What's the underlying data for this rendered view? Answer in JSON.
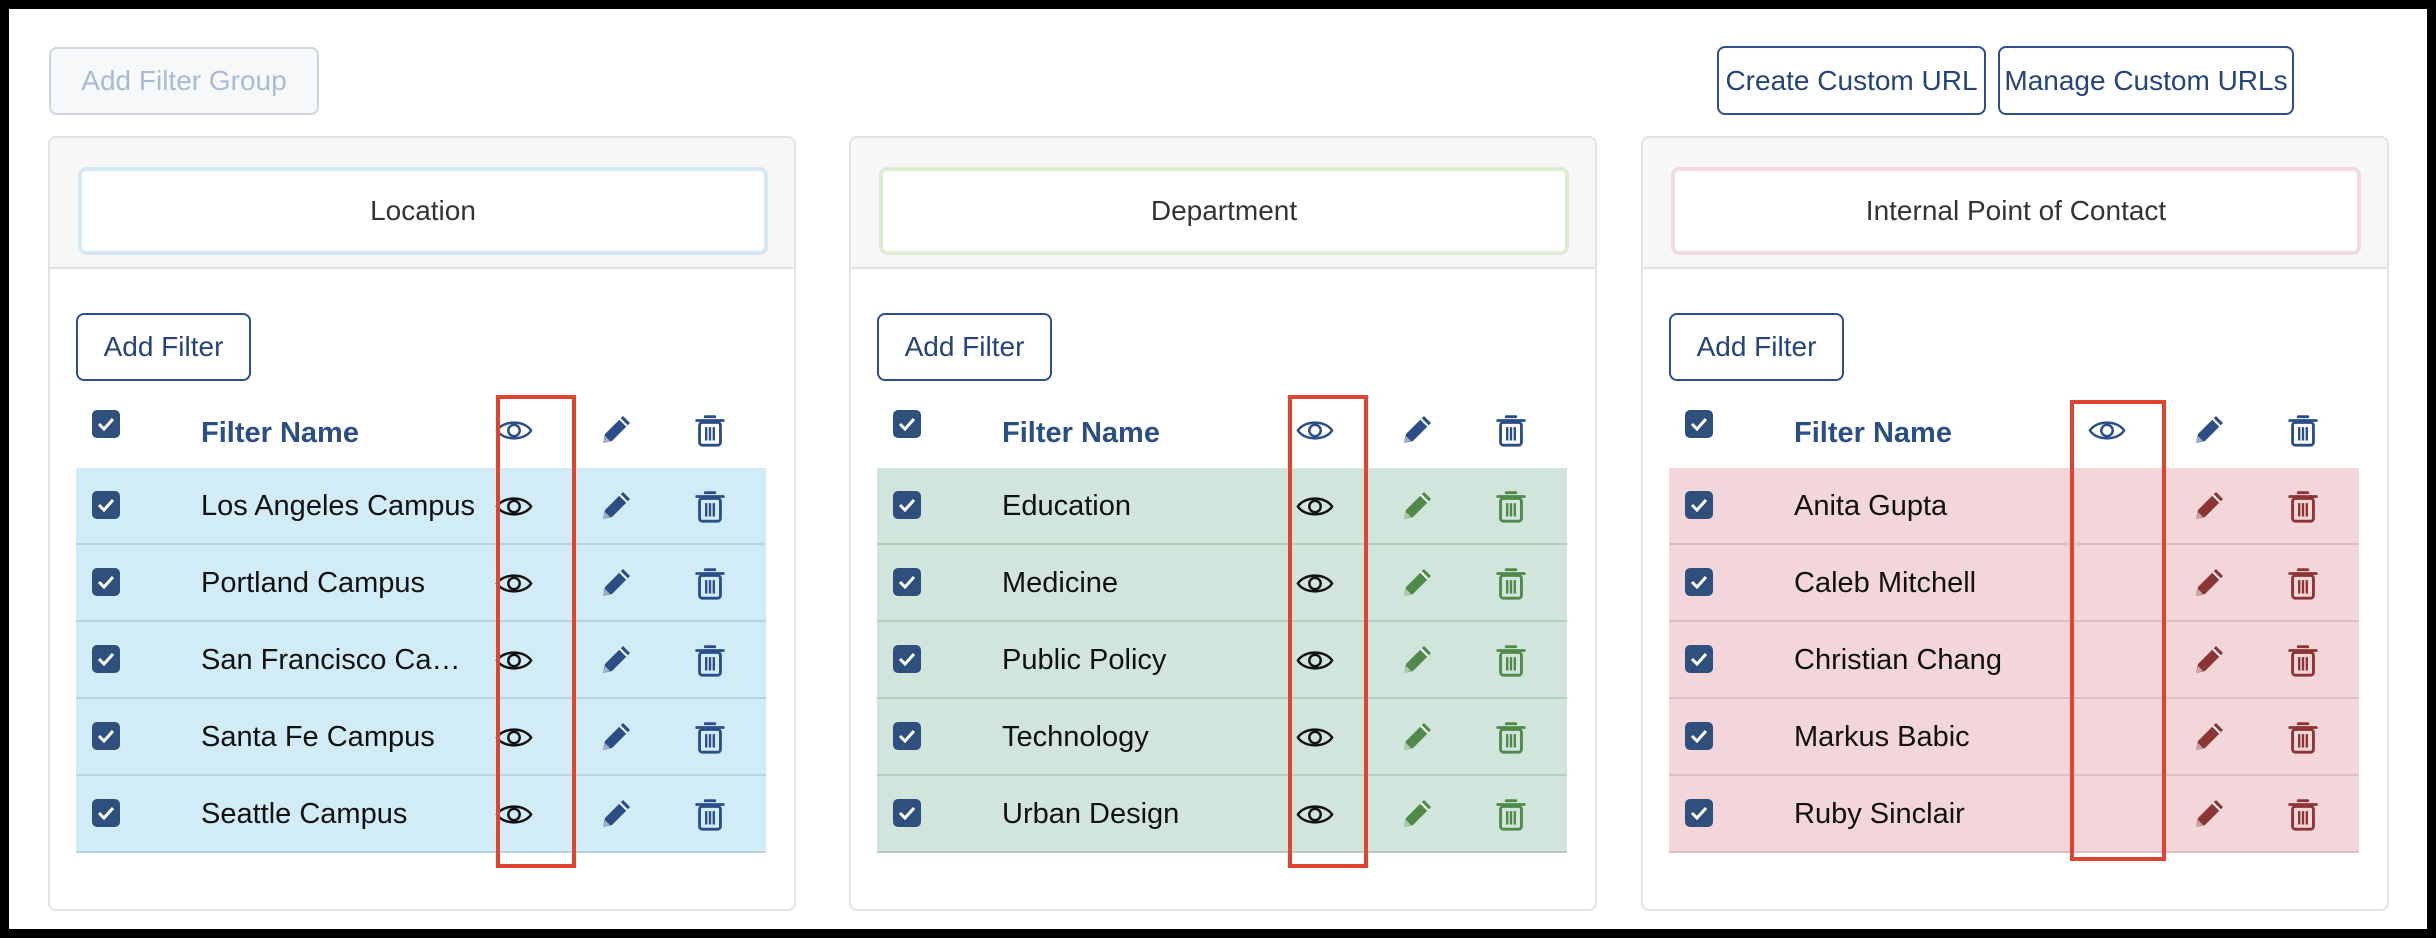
{
  "toolbar": {
    "add_filter_group_label": "Add Filter Group",
    "create_custom_url_label": "Create Custom URL",
    "manage_custom_urls_label": "Manage Custom URLs"
  },
  "colors": {
    "primary": "#2f4f7d",
    "highlight": "#e0442e",
    "location_row": "#d1ecf6",
    "department_row": "#d1e5dc",
    "contact_row": "#f2d6da"
  },
  "groups": [
    {
      "title": "Location",
      "add_filter_label": "Add Filter",
      "column_header": "Filter Name",
      "rows": [
        {
          "name": "Los Angeles Campus"
        },
        {
          "name": "Portland Campus"
        },
        {
          "name": "San Francisco Cam..."
        },
        {
          "name": "Santa Fe Campus"
        },
        {
          "name": "Seattle Campus"
        }
      ]
    },
    {
      "title": "Department",
      "add_filter_label": "Add Filter",
      "column_header": "Filter Name",
      "rows": [
        {
          "name": "Education"
        },
        {
          "name": "Medicine"
        },
        {
          "name": "Public Policy"
        },
        {
          "name": "Technology"
        },
        {
          "name": "Urban Design"
        }
      ]
    },
    {
      "title": "Internal Point of Contact",
      "add_filter_label": "Add Filter",
      "column_header": "Filter Name",
      "rows": [
        {
          "name": "Anita Gupta"
        },
        {
          "name": "Caleb Mitchell"
        },
        {
          "name": "Christian Chang"
        },
        {
          "name": "Markus Babic"
        },
        {
          "name": "Ruby Sinclair"
        }
      ]
    }
  ]
}
